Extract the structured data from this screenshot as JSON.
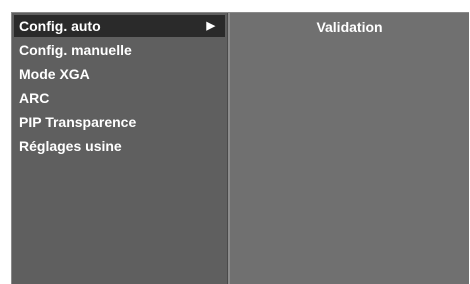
{
  "menu": {
    "items": [
      {
        "label": "Config. auto",
        "selected": true,
        "arrow": "▶"
      },
      {
        "label": "Config. manuelle"
      },
      {
        "label": "Mode XGA"
      },
      {
        "label": "ARC"
      },
      {
        "label": "PIP Transparence"
      },
      {
        "label": "Réglages usine"
      }
    ]
  },
  "submenu": {
    "items": [
      {
        "label": "Validation"
      }
    ]
  },
  "colors": {
    "menu_bg": "#5f5f5f",
    "selected_bg": "#2a2a2a",
    "submenu_bg": "#707070",
    "text": "#ffffff"
  }
}
